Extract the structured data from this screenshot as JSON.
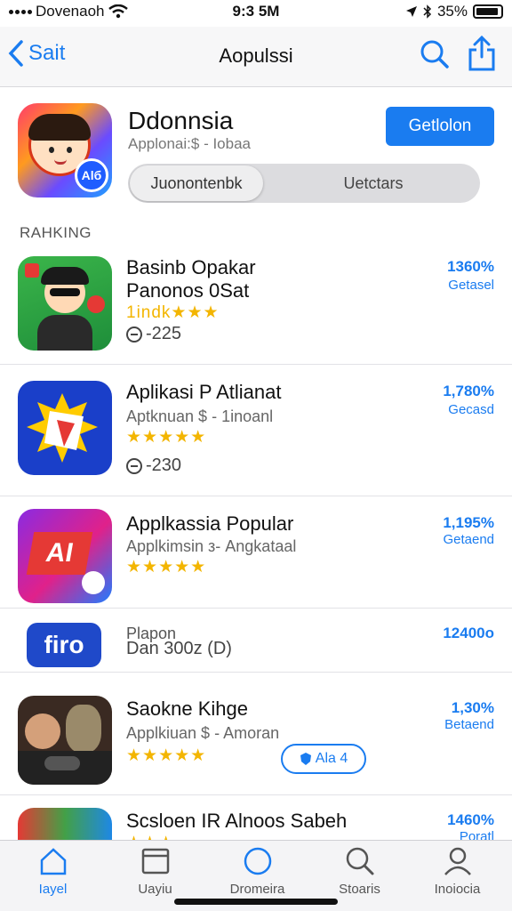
{
  "status": {
    "carrier": "Dovenaoh",
    "time": "9:3 5M",
    "battery": "35%"
  },
  "nav": {
    "back_label": "Sait",
    "title": "Aopulssi"
  },
  "hero": {
    "name": "Ddonnsia",
    "subtitle": "Applonai:$ - Iobaa",
    "badge": "Alб",
    "get_label": "Getlolon",
    "segments": [
      "Juonontenbk",
      "Uetctars"
    ]
  },
  "section_title": "RAHKING",
  "apps": [
    {
      "name": "Basinb Opakar\nPanonos 0Sat",
      "subtitle": "",
      "stars_text": "1indk★★★",
      "extra": "-225",
      "pct": "1360%",
      "status": "Getasel"
    },
    {
      "name": "Aplikasi P Atlianat",
      "subtitle": "Aptknuan $ - 1inoanl",
      "stars_text": "★★★★★",
      "extra": "-230",
      "pct": "1,780%",
      "status": "Gecasd"
    },
    {
      "name": "Applkassia Popular",
      "subtitle": "Applkimsin з- Angkataal",
      "stars_text": "★★★★★",
      "extra": "",
      "pct": "1,195%",
      "status": "Getaend"
    },
    {
      "name": "Plapon",
      "subtitle": "Dan 300z (D)",
      "stars_text": "",
      "extra": "",
      "pct": "12400o",
      "status": "",
      "logo_text": "firo"
    },
    {
      "name": "Saokne Kihge",
      "subtitle": "Applkiuan $ - Amoran",
      "stars_text": "★★★★★",
      "extra": "",
      "pct": "1,30%",
      "status": "Betaend",
      "button": "Ala 4"
    },
    {
      "name": "Scsloen IR Alnoos Sabeh",
      "subtitle": "",
      "stars_text": "",
      "extra": "",
      "pct": "1460%",
      "status": "Poratl"
    }
  ],
  "tabs": [
    {
      "label": "Iayel",
      "icon": "home-icon",
      "active": true
    },
    {
      "label": "Uayiu",
      "icon": "window-icon",
      "active": false
    },
    {
      "label": "Dromeira",
      "icon": "compass-icon",
      "active": false
    },
    {
      "label": "Stoaris",
      "icon": "search-icon",
      "active": false
    },
    {
      "label": "Inoiocia",
      "icon": "person-icon",
      "active": false
    }
  ],
  "colors": {
    "accent": "#1a7cf0",
    "star": "#f3b500"
  }
}
